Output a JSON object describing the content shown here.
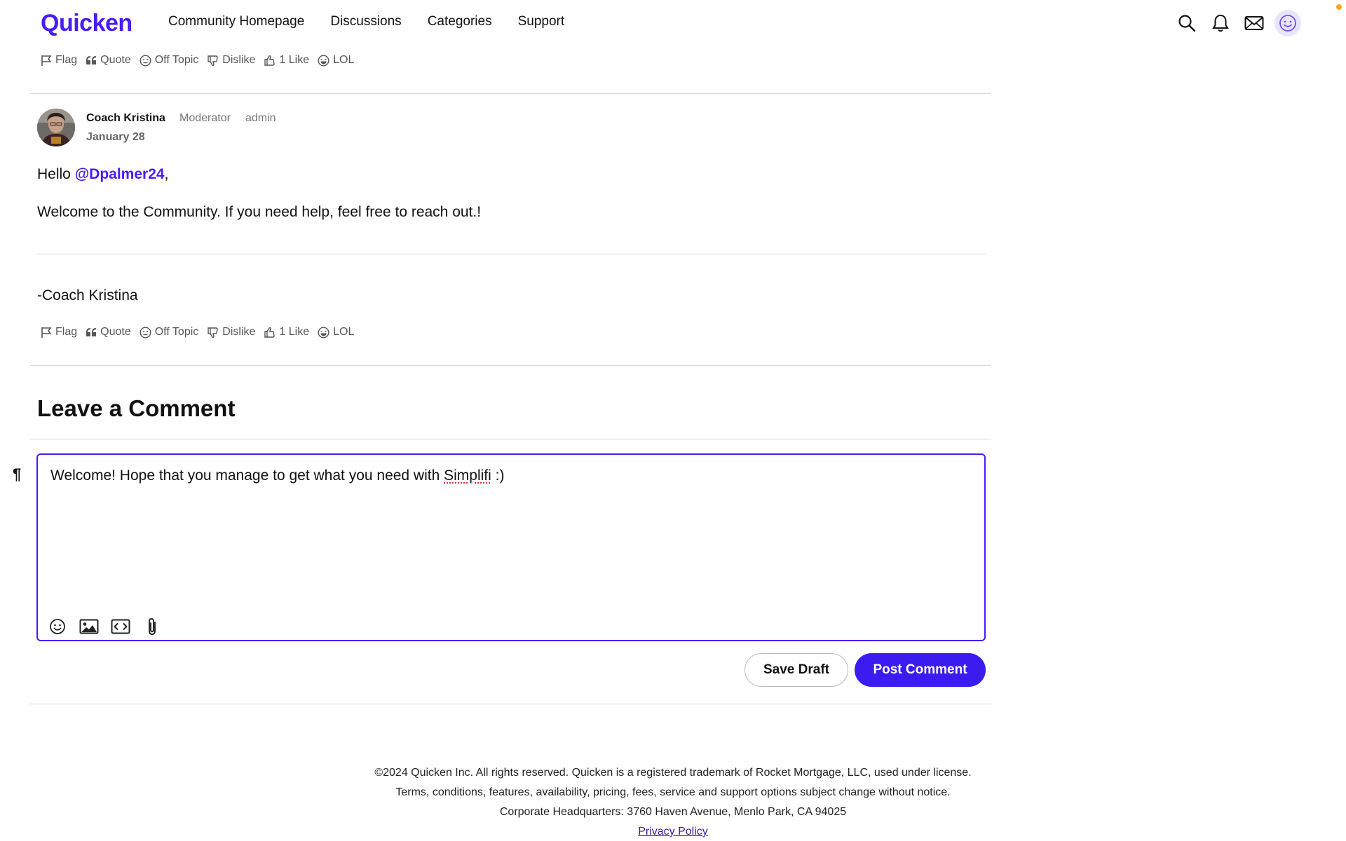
{
  "header": {
    "logo": "Quicken",
    "nav": [
      "Community Homepage",
      "Discussions",
      "Categories",
      "Support"
    ],
    "brand_color": "#471CFF"
  },
  "reactions": {
    "flag": "Flag",
    "quote": "Quote",
    "off_topic": "Off Topic",
    "dislike": "Dislike",
    "like": "1 Like",
    "lol": "LOL"
  },
  "comment": {
    "author": "Coach Kristina",
    "role": "Moderator",
    "role2": "admin",
    "date": "January 28",
    "greeting": "Hello ",
    "mention": "@Dpalmer24",
    "greeting_end": ",",
    "body": "Welcome to the Community. If you need help, feel free to reach out.!",
    "signature": "-Coach Kristina"
  },
  "leave_comment": {
    "title": "Leave a Comment",
    "text_before": "Welcome! Hope that you manage to get what you need with ",
    "text_misspelled": "Simplifi",
    "text_after": " :)",
    "pilcrow": "¶",
    "save_draft": "Save Draft",
    "post_comment": "Post Comment"
  },
  "footer": {
    "line1": "©2024 Quicken Inc. All rights reserved. Quicken is a registered trademark of Rocket Mortgage, LLC, used under license.",
    "line2": "Terms, conditions, features, availability, pricing, fees, service and support options subject change without notice.",
    "line3": "Corporate Headquarters: 3760 Haven Avenue, Menlo Park, CA 94025",
    "privacy": "Privacy Policy"
  }
}
